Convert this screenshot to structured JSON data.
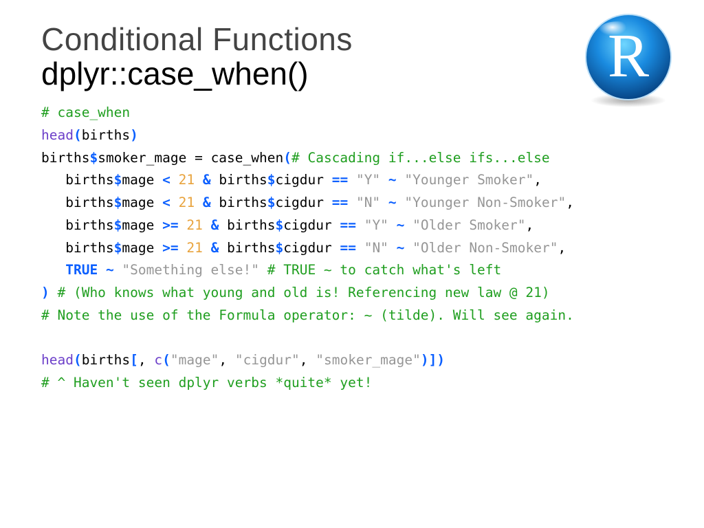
{
  "title": "Conditional Functions",
  "subtitle": "dplyr::case_when()",
  "logo_letter": "R",
  "code": {
    "l1": {
      "comment": "# case_when"
    },
    "l2": {
      "fn": "head",
      "po": "(",
      "arg": "births",
      "pc": ")"
    },
    "l3": {
      "a": "births",
      "d": "$",
      "b": "smoker_mage = case_when",
      "po": "(",
      "cm": "# Cascading if...else ifs...else"
    },
    "l4": {
      "pre": "   births",
      "d": "$",
      "mage": "mage ",
      "lt": "< ",
      "num": "21 ",
      "amp": "& ",
      "b2": "births",
      "d2": "$",
      "cig": "cigdur ",
      "eq": "== ",
      "s1": "\"Y\" ",
      "tilde": "~ ",
      "s2": "\"Younger Smoker\"",
      "comma": ","
    },
    "l5": {
      "pre": "   births",
      "d": "$",
      "mage": "mage ",
      "lt": "< ",
      "num": "21 ",
      "amp": "& ",
      "b2": "births",
      "d2": "$",
      "cig": "cigdur ",
      "eq": "== ",
      "s1": "\"N\" ",
      "tilde": "~ ",
      "s2": "\"Younger Non-Smoker\"",
      "comma": ","
    },
    "l6": {
      "pre": "   births",
      "d": "$",
      "mage": "mage ",
      "lt": ">= ",
      "num": "21 ",
      "amp": "& ",
      "b2": "births",
      "d2": "$",
      "cig": "cigdur ",
      "eq": "== ",
      "s1": "\"Y\" ",
      "tilde": "~ ",
      "s2": "\"Older Smoker\"",
      "comma": ","
    },
    "l7": {
      "pre": "   births",
      "d": "$",
      "mage": "mage ",
      "lt": ">= ",
      "num": "21 ",
      "amp": "& ",
      "b2": "births",
      "d2": "$",
      "cig": "cigdur ",
      "eq": "== ",
      "s1": "\"N\" ",
      "tilde": "~ ",
      "s2": "\"Older Non-Smoker\"",
      "comma": ","
    },
    "l8": {
      "pre": "   ",
      "bool": "TRUE ",
      "tilde": "~ ",
      "s": "\"Something else!\" ",
      "cm": "# TRUE ~ to catch what's left"
    },
    "l9": {
      "pc": ") ",
      "cm": "# (Who knows what young and old is! Referencing new law @ 21)"
    },
    "l10": {
      "cm": "# Note the use of the Formula operator: ~ (tilde). Will see again."
    },
    "l11": {
      "blank": ""
    },
    "l12": {
      "fn": "head",
      "po": "(",
      "arg": "births",
      "bo": "[",
      "comma": ", ",
      "cfn": "c",
      "po2": "(",
      "s1": "\"mage\"",
      "c2": ", ",
      "s2": "\"cigdur\"",
      "c3": ", ",
      "s3": "\"smoker_mage\"",
      "pc2": ")",
      "bc": "]",
      "pc": ")"
    },
    "l13": {
      "cm": "# ^ Haven't seen dplyr verbs *quite* yet!"
    }
  }
}
